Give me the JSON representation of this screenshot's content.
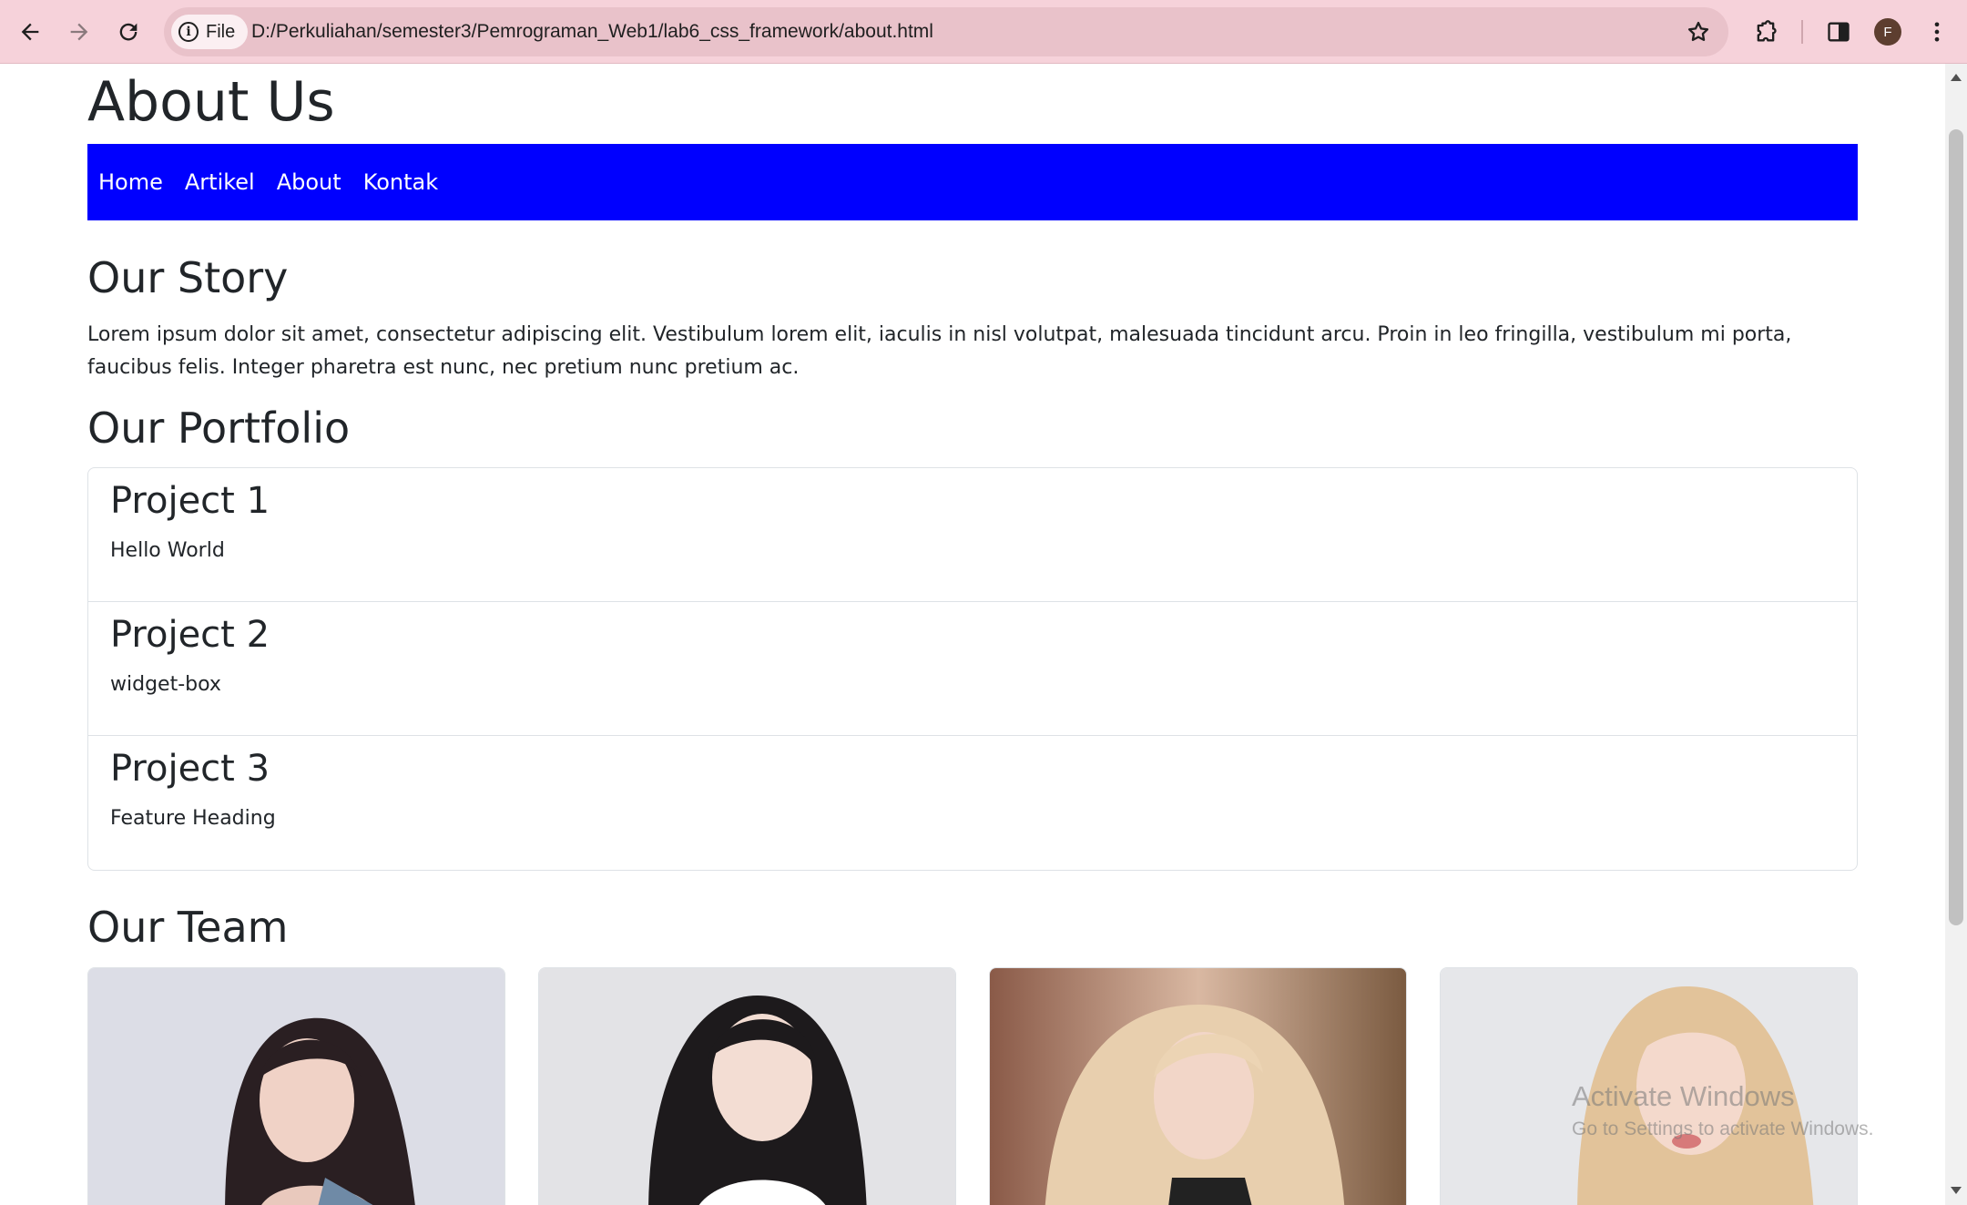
{
  "browser": {
    "site_chip_label": "File",
    "url": "D:/Perkuliahan/semester3/Pemrograman_Web1/lab6_css_framework/about.html",
    "profile_initial": "F",
    "colors": {
      "toolbar": "#f6d2da",
      "omnibox": "#e9c2ca"
    }
  },
  "page": {
    "title": "About Us",
    "nav": [
      "Home",
      "Artikel",
      "About",
      "Kontak"
    ],
    "nav_color": "#0000ff",
    "story": {
      "heading": "Our Story",
      "text": "Lorem ipsum dolor sit amet, consectetur adipiscing elit. Vestibulum lorem elit, iaculis in nisl volutpat, malesuada tincidunt arcu. Proin in leo fringilla, vestibulum mi porta, faucibus felis. Integer pharetra est nunc, nec pretium nunc pretium ac."
    },
    "portfolio": {
      "heading": "Our Portfolio",
      "projects": [
        {
          "title": "Project 1",
          "text": "Hello World"
        },
        {
          "title": "Project 2",
          "text": "widget-box"
        },
        {
          "title": "Project 3",
          "text": "Feature Heading"
        }
      ]
    },
    "team": {
      "heading": "Our Team",
      "members": [
        {
          "photo": "team-photo-1"
        },
        {
          "photo": "team-photo-2"
        },
        {
          "photo": "team-photo-3"
        },
        {
          "photo": "team-photo-4"
        }
      ]
    }
  },
  "watermark": {
    "line1": "Activate Windows",
    "line2": "Go to Settings to activate Windows."
  }
}
